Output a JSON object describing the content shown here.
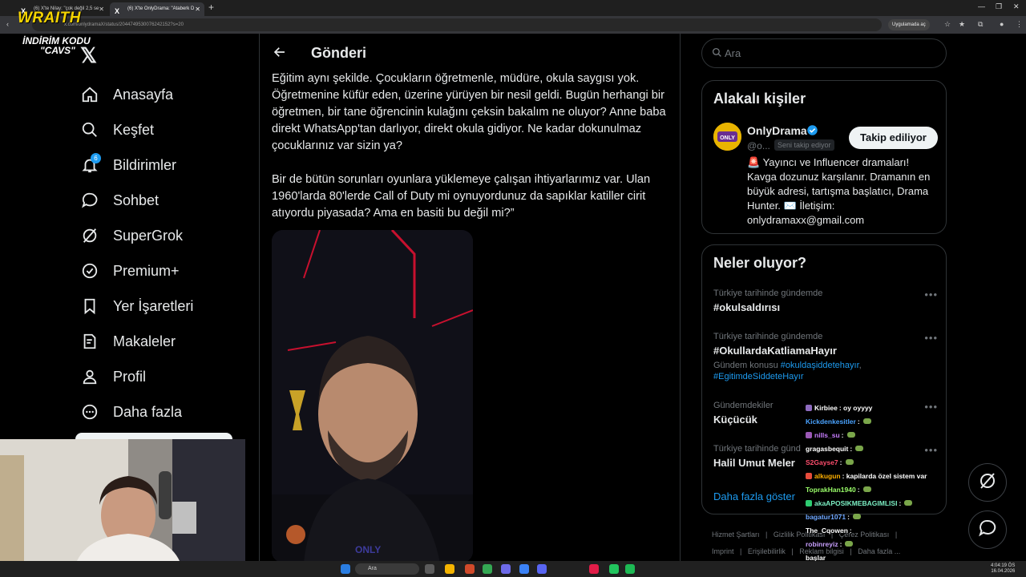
{
  "browser": {
    "tabs": [
      {
        "label": "(6) X'te Nilay: \"çok değil 2,5 se"
      },
      {
        "label": "(6) X'te OnlyDrama: \"Ataberk D"
      }
    ],
    "url": "x.com/onlydramaX/status/2044749530076242152?s=20",
    "app_button": "Uygulamada aç"
  },
  "overlay": {
    "brand": "WRAITH",
    "promo_line1": "İNDİRİM KODU",
    "promo_line2": "\"CAVS\""
  },
  "nav": {
    "items": [
      {
        "label": "Anasayfa",
        "icon": "home-icon"
      },
      {
        "label": "Keşfet",
        "icon": "search-icon"
      },
      {
        "label": "Bildirimler",
        "icon": "bell-icon",
        "badge": "6"
      },
      {
        "label": "Sohbet",
        "icon": "chat-icon"
      },
      {
        "label": "SuperGrok",
        "icon": "grok-icon"
      },
      {
        "label": "Premium+",
        "icon": "verified-icon"
      },
      {
        "label": "Yer İşaretleri",
        "icon": "bookmark-icon"
      },
      {
        "label": "Makaleler",
        "icon": "article-icon"
      },
      {
        "label": "Profil",
        "icon": "profile-icon"
      },
      {
        "label": "Daha fazla",
        "icon": "more-icon"
      }
    ]
  },
  "main": {
    "title": "Gönderi",
    "paragraph1": "Eğitim aynı şekilde. Çocukların öğretmenle, müdüre, okula saygısı yok. Öğretmenine küfür eden, üzerine yürüyen bir nesil geldi. Bugün herhangi bir öğretmen, bir tane öğrencinin kulağını çeksin bakalım ne oluyor? Anne baba direkt WhatsApp'tan darlıyor, direkt okula gidiyor. Ne kadar dokunulmaz çocuklarınız var sizin ya?",
    "paragraph2": "Bir de bütün sorunları oyunlara yüklemeye çalışan ihtiyarlarımız var. Ulan 1960'larda 80'lerde Call of Duty mi oynuyordunuz da sapıklar katiller cirit atıyordu piyasada? Ama en basiti bu değil mi?”",
    "video_text": "ONLY"
  },
  "search": {
    "placeholder": "Ara"
  },
  "related": {
    "title": "Alakalı kişiler",
    "name": "OnlyDrama",
    "handle": "@o...",
    "follows_you": "Seni takip ediyor",
    "follow_button": "Takip ediliyor",
    "bio": "🚨 Yayıncı ve Influencer dramaları! Kavga dozunuz karşılanır. Dramanın en büyük adresi, tartışma başlatıcı, Drama Hunter. ✉️ İletişim: onlydramaxx@gmail.com"
  },
  "trends": {
    "title": "Neler oluyor?",
    "items": [
      {
        "meta": "Türkiye tarihinde gündemde",
        "name": "#okulsaldırısı"
      },
      {
        "meta": "Türkiye tarihinde gündemde",
        "name": "#OkullardaKatliamaHayır",
        "sub_prefix": "Gündem konusu",
        "sub_link1": "#okuldaşiddetehayır",
        "sub_link2": "#EgitimdeSiddeteHayır"
      },
      {
        "meta": "Gündemdekiler",
        "name": "Küçücük"
      },
      {
        "meta": "Türkiye tarihinde günd",
        "name": "Halil Umut Meler"
      }
    ],
    "show_more": "Daha fazla göster"
  },
  "footer": {
    "row1": [
      "Hizmet Şartları",
      "|",
      "Gizlilik Politikası",
      "|",
      "Çerez Politikası",
      "|"
    ],
    "row2": [
      "Imprint",
      "|",
      "Erişilebilirlik",
      "|",
      "Reklam bilgisi",
      "|",
      "Daha fazla ..."
    ]
  },
  "chat": [
    {
      "user": "Kirbiee",
      "msg": ": oy oyyyy",
      "color": "#ffffff",
      "badge": "#8e6bbf"
    },
    {
      "user": "Kickdenkesitler",
      "msg": ":",
      "color": "#4aa3ff",
      "emote": true
    },
    {
      "user": "nills_su",
      "msg": ":",
      "color": "#c77dff",
      "badge": "#9b59b6",
      "emote": true
    },
    {
      "user": "gragasbequit",
      "msg": ":",
      "color": "#ffffff",
      "emote": true
    },
    {
      "user": "S2Gayse7",
      "msg": ":",
      "color": "#ff4d6d",
      "emote": true
    },
    {
      "user": "alkugun",
      "msg": ": kapilarda özel sistem var",
      "color": "#ffb000",
      "badge": "#e74c3c"
    },
    {
      "user": "ToprakHan1940",
      "msg": ":",
      "color": "#9bff6a",
      "emote": true
    },
    {
      "user": "akaAPOSIKMEBAGIMLISI",
      "msg": ":",
      "color": "#7cf0c4",
      "badge": "#2ecc71",
      "emote": true
    },
    {
      "user": "bagatur1071",
      "msg": ":",
      "color": "#6fa8ff",
      "emote": true
    },
    {
      "user": "The_Cqowen",
      "msg": ":",
      "color": "#ffffff"
    },
    {
      "user": "robinreyiz",
      "msg": ":",
      "color": "#c9a0ff",
      "emote": true
    },
    {
      "user": "",
      "msg": "başlar",
      "color": "#ffffff"
    }
  ],
  "taskbar": {
    "search": "Ara",
    "time": "4:04:19 ÖS",
    "date": "16.04.2026"
  },
  "colors": {
    "accent": "#1d9bf0",
    "background": "#000000",
    "border": "#2f3336",
    "muted": "#71767b"
  }
}
